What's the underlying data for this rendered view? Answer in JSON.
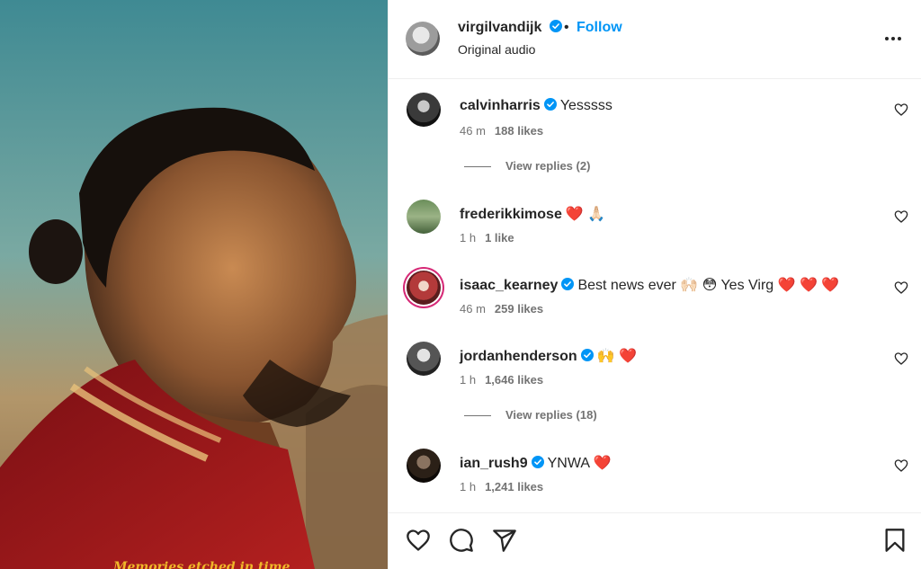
{
  "post": {
    "username": "virgilvandijk",
    "follow_label": "Follow",
    "separator": "•",
    "audio_label": "Original audio",
    "caption_overlay": "Memories etched in time",
    "more_icon": "more-options-icon"
  },
  "comments": [
    {
      "username": "calvinharris",
      "verified": true,
      "text": "Yesssss",
      "time": "46 m",
      "likes": "188 likes",
      "replies": "View replies (2)"
    },
    {
      "username": "frederikkimose",
      "verified": false,
      "text": "❤️ 🙏🏻",
      "time": "1 h",
      "likes": "1 like",
      "replies": null
    },
    {
      "username": "isaac_kearney",
      "verified": true,
      "text": "Best news ever 🙌🏻 😳 Yes Virg ❤️ ❤️ ❤️",
      "time": "46 m",
      "likes": "259 likes",
      "replies": null
    },
    {
      "username": "jordanhenderson",
      "verified": true,
      "text": "🙌 ❤️",
      "time": "1 h",
      "likes": "1,646 likes",
      "replies": "View replies (18)"
    },
    {
      "username": "ian_rush9",
      "verified": true,
      "text": "YNWA ❤️",
      "time": "1 h",
      "likes": "1,241 likes",
      "replies": null
    }
  ],
  "actions": {
    "like_icon": "heart-icon",
    "comment_icon": "comment-icon",
    "share_icon": "share-icon",
    "save_icon": "bookmark-icon"
  },
  "colors": {
    "accent": "#0095f6",
    "verified": "#0095f6",
    "text": "#262626",
    "muted": "#737373",
    "jersey_red": "#a3161b"
  }
}
